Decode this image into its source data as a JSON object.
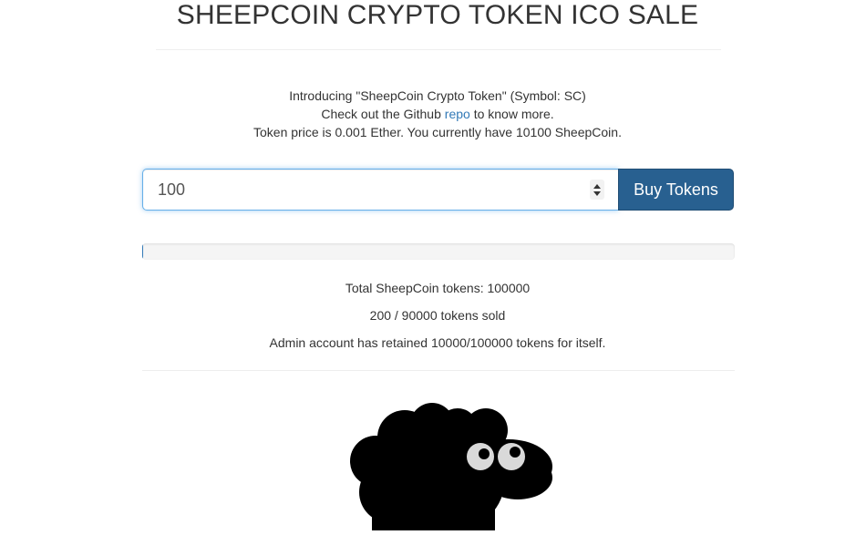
{
  "header": {
    "title": "SHEEPCOIN CRYPTO TOKEN ICO SALE"
  },
  "intro": {
    "line1": "Introducing \"SheepCoin Crypto Token\" (Symbol: SC)",
    "line2_before": "Check out the Github ",
    "line2_link": "repo",
    "line2_after": " to know more.",
    "line3": "Token price is 0.001 Ether. You currently have 10100 SheepCoin."
  },
  "purchase": {
    "quantity_value": "100",
    "buy_label": "Buy Tokens"
  },
  "progress": {
    "sold": 200,
    "available": 90000
  },
  "stats": {
    "total": "Total SheepCoin tokens: 100000",
    "sold": "200 / 90000 tokens sold",
    "admin": "Admin account has retained 10000/100000 tokens for itself."
  },
  "colors": {
    "primary": "#337ab7",
    "button": "#286090",
    "text": "#333333"
  },
  "icons": {
    "mascot": "sheep-mascot-icon",
    "spinner": "number-spinner-icon"
  }
}
